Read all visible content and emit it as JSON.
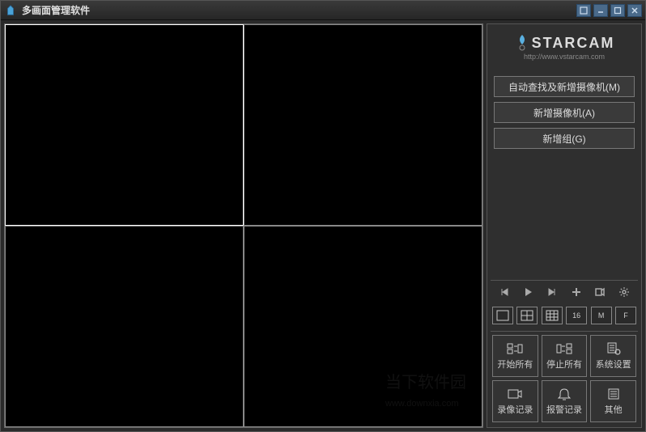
{
  "window": {
    "title": "多画面管理软件"
  },
  "brand": {
    "name": "STARCAM",
    "url": "http://www.vstarcam.com"
  },
  "config_buttons": {
    "auto_search": "自动查找及新增摄像机(M)",
    "add_camera": "新增摄像机(A)",
    "add_group": "新增组(G)"
  },
  "layout_buttons": {
    "count16": "16",
    "mode_m": "M",
    "mode_f": "F"
  },
  "actions": {
    "start_all": "开始所有",
    "stop_all": "停止所有",
    "system_settings": "系统设置",
    "video_record": "录像记录",
    "alarm_record": "报警记录",
    "other": "其他"
  },
  "watermark": {
    "text": "当下软件园",
    "site": "www.downxia.com"
  }
}
